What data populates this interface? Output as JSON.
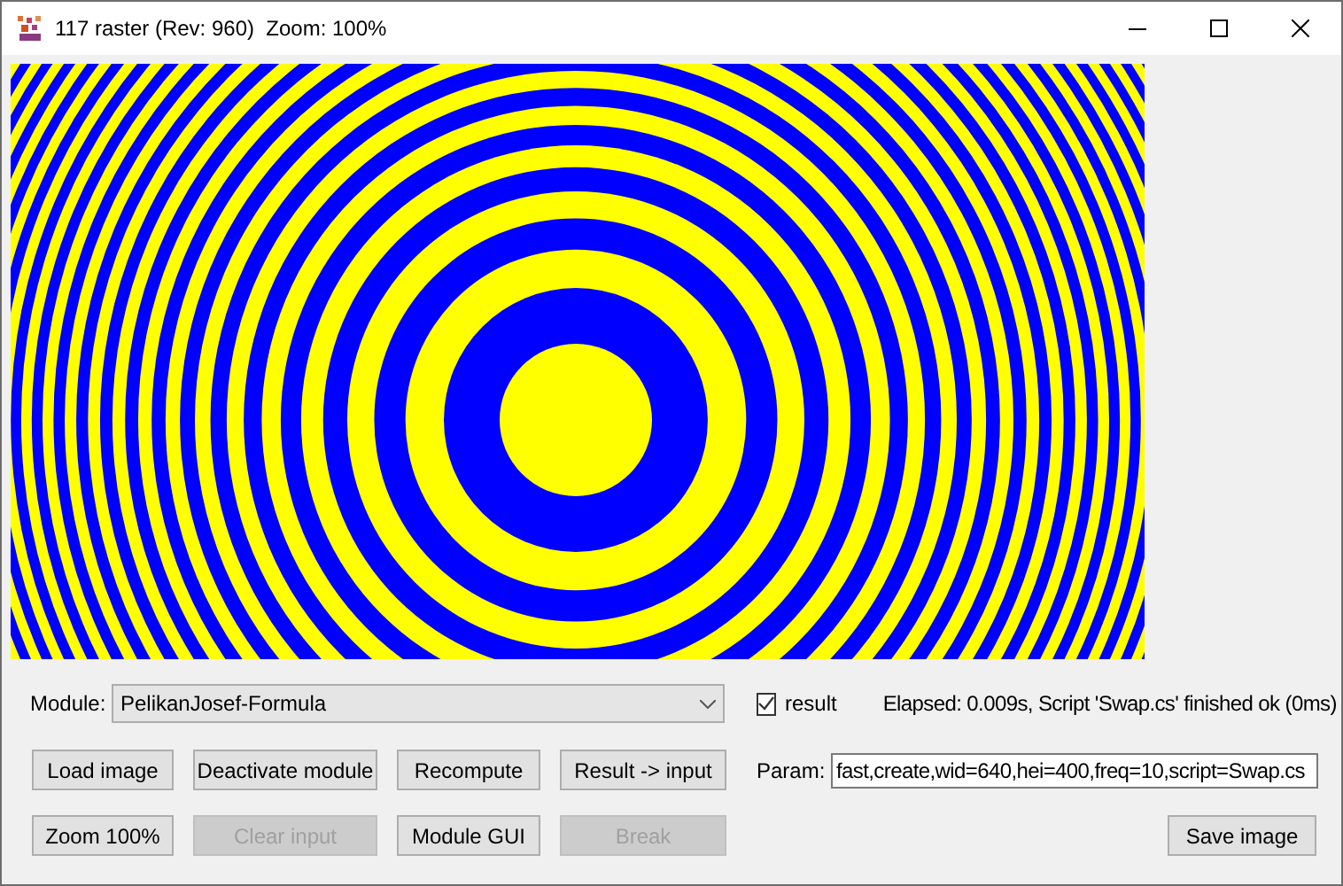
{
  "window": {
    "title": "117 raster (Rev: 960)  Zoom: 100%"
  },
  "module": {
    "label": "Module:",
    "value": "PelikanJosef-Formula"
  },
  "result_checkbox": {
    "label": "result",
    "checked": true
  },
  "status": "Elapsed: 0.009s, Script 'Swap.cs' finished ok (0ms)",
  "param": {
    "label": "Param:",
    "value": "fast,create,wid=640,hei=400,freq=10,script=Swap.cs"
  },
  "buttons": [
    {
      "label": "Load image",
      "disabled": false
    },
    {
      "label": "Deactivate module",
      "disabled": false
    },
    {
      "label": "Recompute",
      "disabled": false
    },
    {
      "label": "Result -> input",
      "disabled": false
    },
    {
      "label": "Zoom 100%",
      "disabled": false
    },
    {
      "label": "Clear input",
      "disabled": true
    },
    {
      "label": "Module GUI",
      "disabled": false
    },
    {
      "label": "Break",
      "disabled": true
    }
  ],
  "save_button": {
    "label": "Save image",
    "disabled": false
  }
}
